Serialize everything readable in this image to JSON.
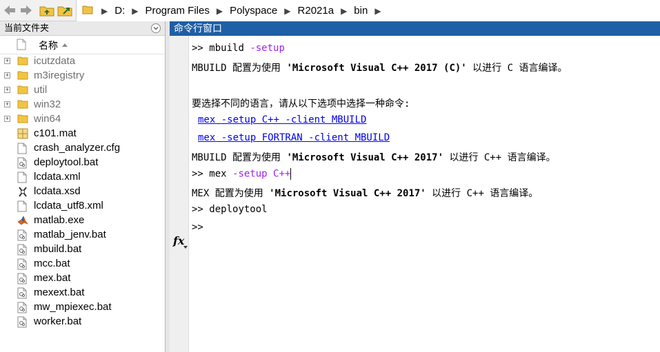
{
  "address_bar": {
    "segments": [
      "D:",
      "Program Files",
      "Polyspace",
      "R2021a",
      "bin"
    ]
  },
  "file_panel": {
    "title": "当前文件夹",
    "column_name": "名称",
    "items": [
      {
        "name": "icutzdata",
        "type": "folder"
      },
      {
        "name": "m3iregistry",
        "type": "folder"
      },
      {
        "name": "util",
        "type": "folder"
      },
      {
        "name": "win32",
        "type": "folder"
      },
      {
        "name": "win64",
        "type": "folder"
      },
      {
        "name": "c101.mat",
        "type": "mat"
      },
      {
        "name": "crash_analyzer.cfg",
        "type": "file"
      },
      {
        "name": "deploytool.bat",
        "type": "bat"
      },
      {
        "name": "lcdata.xml",
        "type": "file"
      },
      {
        "name": "lcdata.xsd",
        "type": "xsd"
      },
      {
        "name": "lcdata_utf8.xml",
        "type": "file"
      },
      {
        "name": "matlab.exe",
        "type": "exe"
      },
      {
        "name": "matlab_jenv.bat",
        "type": "bat"
      },
      {
        "name": "mbuild.bat",
        "type": "bat"
      },
      {
        "name": "mcc.bat",
        "type": "bat"
      },
      {
        "name": "mex.bat",
        "type": "bat"
      },
      {
        "name": "mexext.bat",
        "type": "bat"
      },
      {
        "name": "mw_mpiexec.bat",
        "type": "bat"
      },
      {
        "name": "worker.bat",
        "type": "bat"
      }
    ]
  },
  "command_window": {
    "title": "命令行窗口",
    "prompt": ">>",
    "fx_label": "fx",
    "lines": {
      "l1_cmd": "mbuild",
      "l1_arg": "-setup",
      "l2_a": "MBUILD 配置为使用 ",
      "l2_b": "'Microsoft Visual C++ 2017 (C)'",
      "l2_c": " 以进行 C 语言编译。",
      "l3": "要选择不同的语言，请从以下选项中选择一种命令:",
      "l4_link": "mex -setup C++ -client MBUILD",
      "l5_link": "mex -setup FORTRAN -client MBUILD",
      "l6_a": "MBUILD 配置为使用 ",
      "l6_b": "'Microsoft Visual C++ 2017'",
      "l6_c": " 以进行 C++ 语言编译。",
      "l7_cmd": "mex",
      "l7_arg": "-setup C++",
      "l8_a": "MEX 配置为使用 ",
      "l8_b": "'Microsoft Visual C++ 2017'",
      "l8_c": " 以进行 C++ 语言编译。",
      "l9_cmd": "deploytool"
    }
  },
  "colors": {
    "title_bar_blue": "#1e5fa6",
    "keyword_purple": "#a020f0",
    "link_blue": "#0000ee",
    "folder_yellow": "#f3c443"
  }
}
